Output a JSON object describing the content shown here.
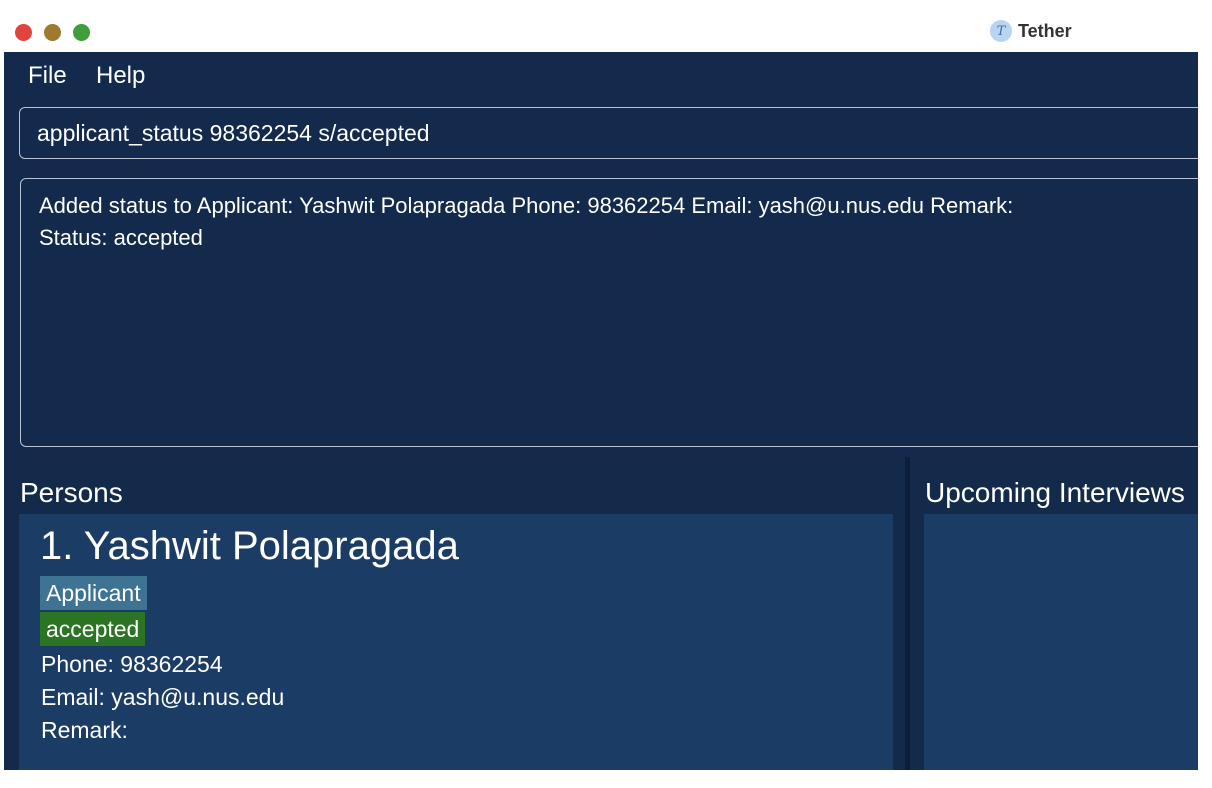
{
  "window": {
    "title": "Tether",
    "icon": "tether-app-icon"
  },
  "menu": {
    "file": "File",
    "help": "Help"
  },
  "command": {
    "value": "applicant_status 98362254 s/accepted"
  },
  "result": {
    "line1": "Added status to Applicant: Yashwit Polapragada Phone: 98362254 Email: yash@u.nus.edu Remark:",
    "line2": "Status: accepted"
  },
  "persons": {
    "heading": "Persons",
    "items": [
      {
        "name": "1. Yashwit Polapragada",
        "role_tag": "Applicant",
        "status_tag": "accepted",
        "phone": "Phone: 98362254",
        "email": "Email: yash@u.nus.edu",
        "remark": "Remark:"
      }
    ]
  },
  "interviews": {
    "heading": "Upcoming Interviews"
  },
  "colors": {
    "background": "#132a4c",
    "card": "#1b3c65",
    "tag_role": "#3f7394",
    "tag_status": "#2b7424"
  }
}
